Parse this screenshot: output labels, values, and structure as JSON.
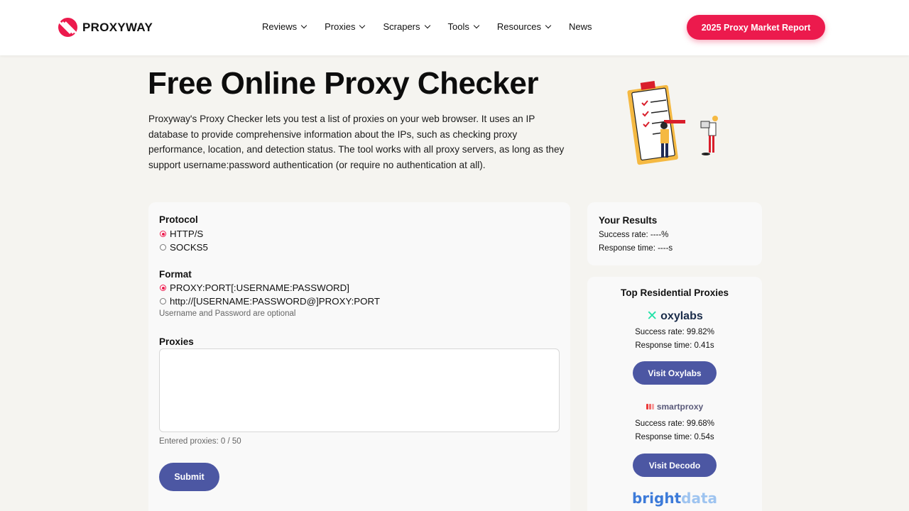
{
  "header": {
    "logo_text": "PROXYWAY",
    "nav": [
      {
        "label": "Reviews",
        "has_dropdown": true
      },
      {
        "label": "Proxies",
        "has_dropdown": true
      },
      {
        "label": "Scrapers",
        "has_dropdown": true
      },
      {
        "label": "Tools",
        "has_dropdown": true
      },
      {
        "label": "Resources",
        "has_dropdown": true
      },
      {
        "label": "News",
        "has_dropdown": false
      }
    ],
    "cta_label": "2025 Proxy Market Report"
  },
  "hero": {
    "title": "Free Online Proxy Checker",
    "intro": "Proxyway's Proxy Checker lets you test a list of proxies on your web browser. It uses an IP database to provide comprehensive information about the IPs, such as checking proxy performance, location, and detection status. The tool works with all proxy servers, as long as they support username:password authentication (or require no authentication at all)."
  },
  "checker": {
    "protocol_label": "Protocol",
    "protocol_options": [
      {
        "label": "HTTP/S",
        "selected": true
      },
      {
        "label": "SOCKS5",
        "selected": false
      }
    ],
    "format_label": "Format",
    "format_options": [
      {
        "label": "PROXY:PORT[:USERNAME:PASSWORD]",
        "selected": true
      },
      {
        "label": "http://[USERNAME:PASSWORD@]PROXY:PORT",
        "selected": false
      }
    ],
    "format_hint": "Username and Password are optional",
    "proxies_label": "Proxies",
    "proxies_value": "",
    "entered_count": "Entered proxies: 0 / 50",
    "submit_label": "Submit"
  },
  "results": {
    "title": "Your Results",
    "success_rate": "Success rate: ----%",
    "response_time": "Response time: ----s"
  },
  "providers": {
    "title": "Top Residential Proxies",
    "items": [
      {
        "brand": "oxylabs",
        "success_rate": "Success rate: 99.82%",
        "response_time": "Response time: 0.41s",
        "button": "Visit Oxylabs"
      },
      {
        "brand": "smartproxy",
        "success_rate": "Success rate: 99.68%",
        "response_time": "Response time: 0.54s",
        "button": "Visit Decodo"
      },
      {
        "brand_part1": "bright",
        "brand_part2": "data"
      }
    ]
  },
  "colors": {
    "accent": "#ec1a4d",
    "button": "#4c57a3",
    "page_bg": "#f5f4f0"
  },
  "icons": [
    "proxyway-logo-icon",
    "chevron-down-icon",
    "oxylabs-logo-icon",
    "smartproxy-logo-icon",
    "checklist-illustration"
  ]
}
